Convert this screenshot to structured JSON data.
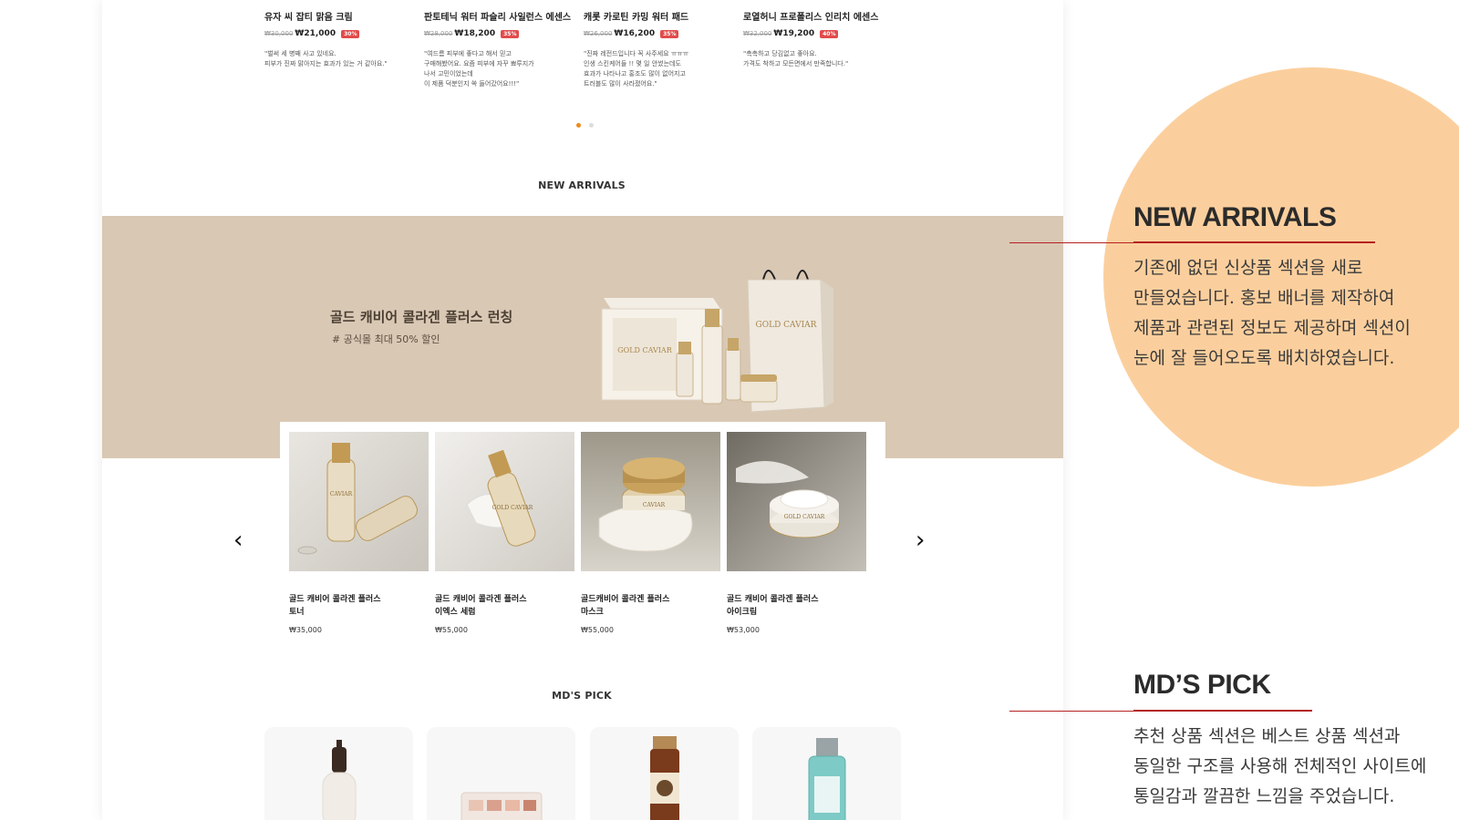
{
  "reviews": [
    {
      "name": "유자 씨 잡티 맑음 크림",
      "old_price": "₩30,000",
      "price": "₩21,000",
      "discount": "30%",
      "text": "\"벌써 세 병째 사고 있네요.\n피부가 진짜 맑아지는 효과가 있는 거 같아요.\""
    },
    {
      "name": "판토테닉 워터 파슬리 사일런스 에센스",
      "old_price": "₩28,000",
      "price": "₩18,200",
      "discount": "35%",
      "text": "\"여드름 피부에 좋다고 해서 믿고\n구매해봤어요. 요즘 피부에 자꾸 뾰루지가\n나서 고민이었는데\n이 제품 덕분인지 쏙 들어갔어요!!!\""
    },
    {
      "name": "캐롯 카로틴 카밍 워터 패드",
      "old_price": "₩26,000",
      "price": "₩16,200",
      "discount": "35%",
      "text": "\"진짜 레전드입니다 꼭 사주세요 ㅠㅠㅠ\n인생 스킨케어들 !! 몇 일 안썼는데도\n효과가 나타나고 홍조도 많이 없어지고\n트러블도 많이 사라졌어요.\""
    },
    {
      "name": "로열허니 프로폴리스 인리치 에센스",
      "old_price": "₩32,000",
      "price": "₩19,200",
      "discount": "40%",
      "text": "\"촉촉하고 당김없고 좋아요.\n가격도 착하고 모든면에서 만족합니다.\""
    }
  ],
  "section_titles": {
    "new_arrivals": "NEW ARRIVALS",
    "mds_pick": "MD'S PICK"
  },
  "banner": {
    "title": "골드 캐비어 콜라겐 플러스 런칭",
    "subtitle": "# 공식몰 최대 50% 할인",
    "bag_text": "GOLD CAVIAR",
    "box_text": "GOLD CAVIAR"
  },
  "products": [
    {
      "name": "골드 캐비어 콜라겐 플러스\n토너",
      "price": "₩35,000",
      "img_label": "CAVIAR"
    },
    {
      "name": "골드 캐비어 콜라겐 플러스\n이엑스 세럼",
      "price": "₩55,000",
      "img_label": "GOLD CAVIAR"
    },
    {
      "name": "골드캐비어 콜라겐 플러스\n마스크",
      "price": "₩55,000",
      "img_label": "CAVIAR"
    },
    {
      "name": "골드 캐비어 콜라겐 플러스\n아이크림",
      "price": "₩53,000",
      "img_label": "GOLD CAVIAR"
    }
  ],
  "nav": {
    "prev_glyph": "‹",
    "next_glyph": "›"
  },
  "annotations": {
    "new_arrivals": {
      "title": "NEW ARRIVALS",
      "body": "기존에 없던 신상품 섹션을 새로\n만들었습니다. 홍보 배너를 제작하여\n제품과 관련된 정보도 제공하며 섹션이\n눈에 잘 들어오도록 배치하였습니다."
    },
    "mds_pick": {
      "title": "MD’S PICK",
      "body": "추천 상품 섹션은 베스트 상품 섹션과\n동일한 구조를 사용해 전체적인 사이트에\n통일감과 깔끔한 느낌을 주었습니다."
    }
  },
  "colors": {
    "accent_orange": "#f08a1c",
    "discount_red": "#e24b4b",
    "banner_beige": "#d9c8b4",
    "annotation_circle": "#fbcf9d",
    "annotation_line": "#b52020"
  }
}
